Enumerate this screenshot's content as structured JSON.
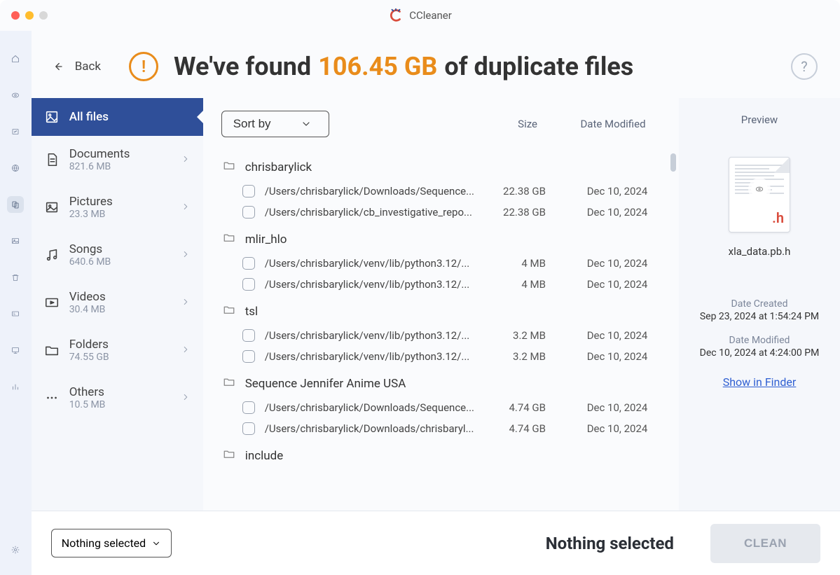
{
  "app_title": "CCleaner",
  "back_label": "Back",
  "headline_prefix": "We've found",
  "headline_size": "106.45 GB",
  "headline_suffix": "of duplicate files",
  "rail": [
    "home",
    "eye",
    "archive",
    "globe",
    "duplicate",
    "image",
    "trash",
    "card",
    "screen",
    "stats"
  ],
  "sidebar": {
    "all_files": {
      "label": "All files"
    },
    "categories": [
      {
        "icon": "doc",
        "label": "Documents",
        "sub": "821.6 MB"
      },
      {
        "icon": "pic",
        "label": "Pictures",
        "sub": "23.3 MB"
      },
      {
        "icon": "song",
        "label": "Songs",
        "sub": "640.6 MB"
      },
      {
        "icon": "video",
        "label": "Videos",
        "sub": "30.4 MB"
      },
      {
        "icon": "folder",
        "label": "Folders",
        "sub": "74.55 GB"
      },
      {
        "icon": "other",
        "label": "Others",
        "sub": "10.5 MB"
      }
    ]
  },
  "sort_label": "Sort by",
  "columns": {
    "size": "Size",
    "date": "Date Modified",
    "preview": "Preview"
  },
  "groups": [
    {
      "name": "chrisbarylick",
      "files": [
        {
          "path": "/Users/chrisbarylick/Downloads/Sequence...",
          "size": "22.38 GB",
          "date": "Dec 10, 2024"
        },
        {
          "path": "/Users/chrisbarylick/cb_investigative_repo...",
          "size": "22.38 GB",
          "date": "Dec 10, 2024"
        }
      ]
    },
    {
      "name": "mlir_hlo",
      "files": [
        {
          "path": "/Users/chrisbarylick/venv/lib/python3.12/...",
          "size": "4 MB",
          "date": "Dec 10, 2024"
        },
        {
          "path": "/Users/chrisbarylick/venv/lib/python3.12/...",
          "size": "4 MB",
          "date": "Dec 10, 2024"
        }
      ]
    },
    {
      "name": "tsl",
      "files": [
        {
          "path": "/Users/chrisbarylick/venv/lib/python3.12/...",
          "size": "3.2 MB",
          "date": "Dec 10, 2024"
        },
        {
          "path": "/Users/chrisbarylick/venv/lib/python3.12/...",
          "size": "3.2 MB",
          "date": "Dec 10, 2024"
        }
      ]
    },
    {
      "name": "Sequence Jennifer Anime USA",
      "files": [
        {
          "path": "/Users/chrisbarylick/Downloads/Sequence...",
          "size": "4.74 GB",
          "date": "Dec 10, 2024"
        },
        {
          "path": "/Users/chrisbarylick/Downloads/chrisbaryl...",
          "size": "4.74 GB",
          "date": "Dec 10, 2024"
        }
      ]
    },
    {
      "name": "include",
      "files": []
    }
  ],
  "preview": {
    "filename": "xla_data.pb.h",
    "created_label": "Date Created",
    "created_val": "Sep 23, 2024 at 1:54:24 PM",
    "modified_label": "Date Modified",
    "modified_val": "Dec 10, 2024 at 4:24:00 PM",
    "finder_link": "Show in Finder"
  },
  "footer": {
    "selection_dropdown": "Nothing selected",
    "status": "Nothing selected",
    "clean": "CLEAN"
  }
}
